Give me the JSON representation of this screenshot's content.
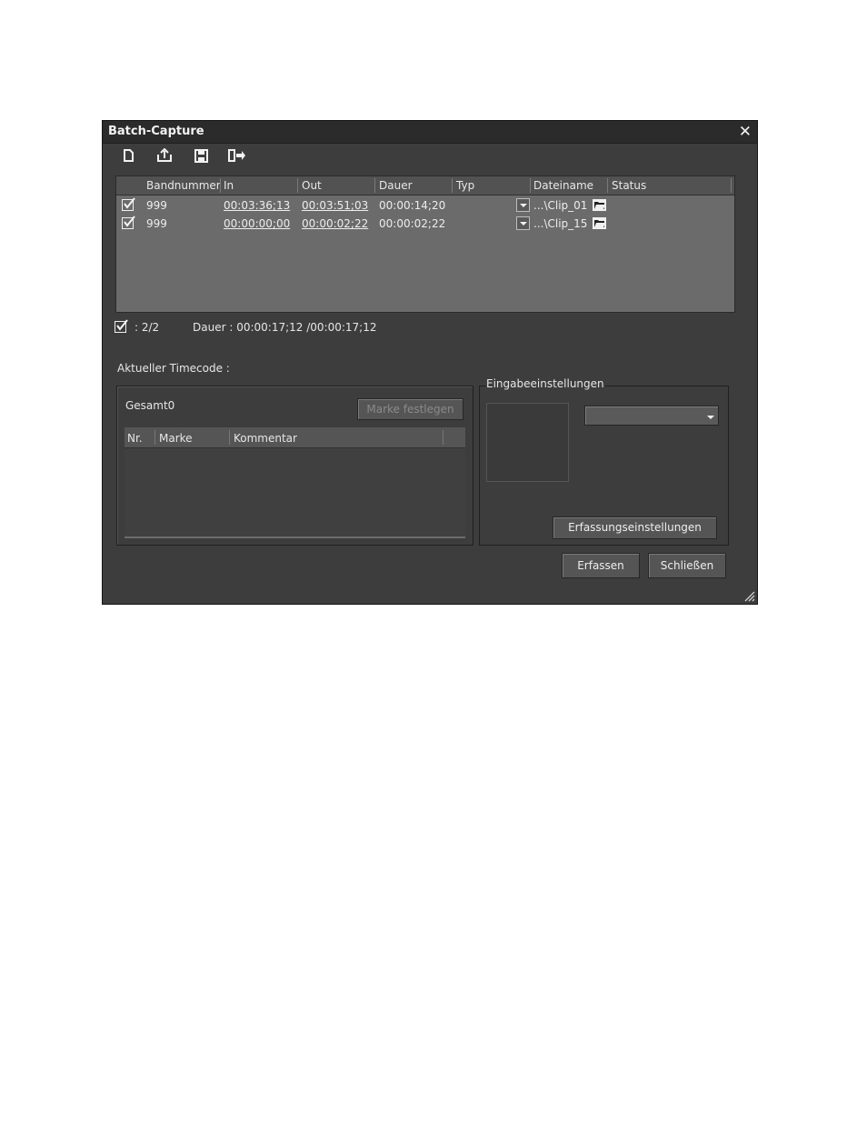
{
  "window": {
    "title": "Batch-Capture",
    "close_glyph": "✕"
  },
  "toolbar": {
    "buttons": [
      {
        "icon": "new-document-icon"
      },
      {
        "icon": "export-icon"
      },
      {
        "icon": "save-icon"
      },
      {
        "icon": "import-list-icon"
      }
    ]
  },
  "table": {
    "columns": [
      "Bandnummer",
      "In",
      "Out",
      "Dauer",
      "Typ",
      "Dateiname",
      "Status"
    ],
    "rows": [
      {
        "checked": true,
        "bandnummer": "999",
        "in": "00:03:36;13",
        "out": "00:03:51;03",
        "dauer": "00:00:14;20",
        "typ": "",
        "dateiname": "...\\Clip_01",
        "status": ""
      },
      {
        "checked": true,
        "bandnummer": "999",
        "in": "00:00:00;00",
        "out": "00:00:02;22",
        "dauer": "00:00:02;22",
        "typ": "",
        "dateiname": "...\\Clip_15",
        "status": ""
      }
    ]
  },
  "summary": {
    "count": ": 2/2",
    "duration": "Dauer : 00:00:17;12 /00:00:17;12"
  },
  "timecode": {
    "label": "Aktueller Timecode :"
  },
  "marks": {
    "total_label": "Gesamt0",
    "set_mark_button": "Marke festlegen",
    "columns": [
      "Nr.",
      "Marke",
      "Kommentar"
    ]
  },
  "input_settings": {
    "legend": "Eingabeeinstellungen",
    "selected_value": "",
    "capture_settings_button": "Erfassungseinstellungen"
  },
  "footer": {
    "capture_button": "Erfassen",
    "close_button": "Schließen"
  }
}
